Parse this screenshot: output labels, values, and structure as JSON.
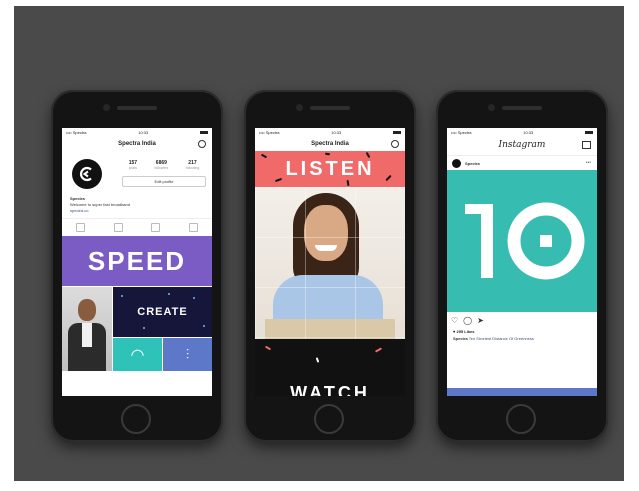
{
  "phones": {
    "profile": {
      "status_carrier": "•••• Spectra",
      "status_time": "10:33",
      "title": "Spectra India",
      "stats": [
        {
          "count": "157",
          "label": "posts"
        },
        {
          "count": "6869",
          "label": "followers"
        },
        {
          "count": "217",
          "label": "following"
        }
      ],
      "edit_label": "Edit profile",
      "bio_name": "Spectra",
      "bio_text": "Welcome to super fast broadband",
      "bio_link": "spectra.co",
      "tile_speed": "SPEED",
      "tile_create": "CREATE"
    },
    "story": {
      "status_carrier": "•••• Spectra",
      "status_time": "10:33",
      "title": "Spectra India",
      "banner_top": "LISTEN",
      "banner_bottom": "WATCH"
    },
    "feed": {
      "status_carrier": "•••• Spectra",
      "status_time": "10:33",
      "brand": "Instagram",
      "post_user": "Spectra",
      "big_number": "10",
      "likes": "♥ 295 Likes",
      "caption_user": "Spectra",
      "caption_text": "Ten Shortest Distance Of Greenness"
    }
  },
  "colors": {
    "background": "#4a4a4a",
    "purple": "#7b5cc4",
    "coral": "#f06a6a",
    "teal": "#36bcb0",
    "navy": "#16163a",
    "blue": "#5d78c8"
  }
}
